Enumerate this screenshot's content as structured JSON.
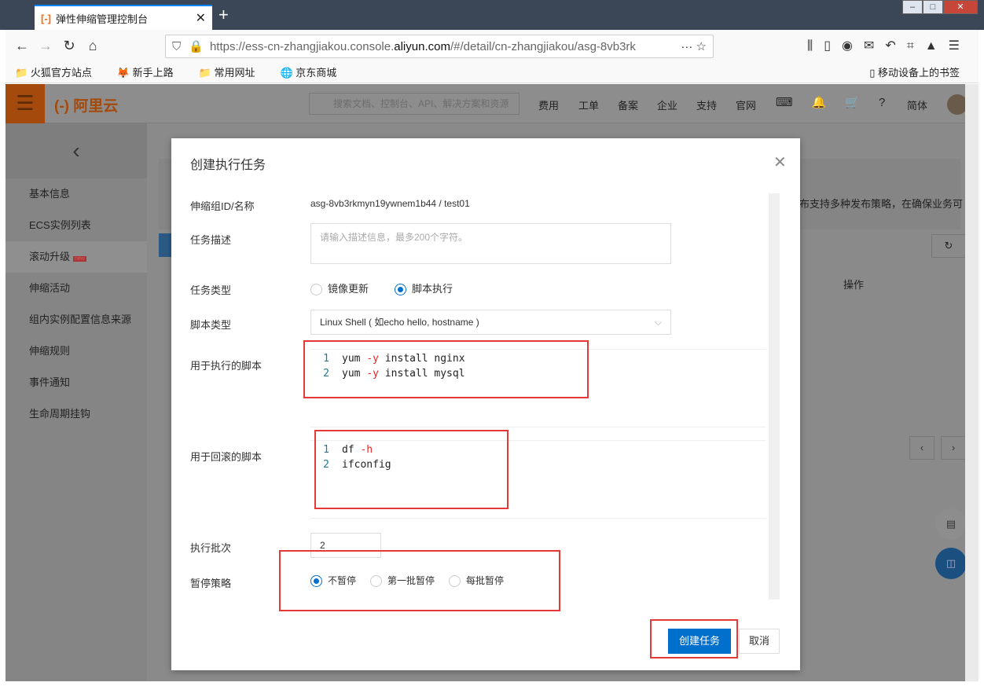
{
  "browser": {
    "tab_title": "弹性伸缩管理控制台",
    "url_prefix": "https://ess-cn-zhangjiakou.console.",
    "url_domain": "aliyun.com",
    "url_suffix": "/#/detail/cn-zhangjiakou/asg-8vb3rk",
    "bookmarks": [
      "火狐官方站点",
      "新手上路",
      "常用网址",
      "京东商城"
    ],
    "mobile_bookmarks": "移动设备上的书签"
  },
  "console": {
    "brand": "阿里云",
    "search_placeholder": "搜索文档、控制台、API、解决方案和资源",
    "nav": [
      "费用",
      "工单",
      "备案",
      "企业",
      "支持",
      "官网"
    ],
    "lang": "简体",
    "sidebar": [
      "基本信息",
      "ECS实例列表",
      "滚动升级",
      "伸缩活动",
      "组内实例配置信息来源",
      "伸缩规则",
      "事件通知",
      "生命周期挂钩"
    ],
    "new_badge": "new",
    "banner_text": "布支持多种发布策略，在确保业务可",
    "column_ops": "操作"
  },
  "modal": {
    "title": "创建执行任务",
    "group_label": "伸缩组ID/名称",
    "group_value": "asg-8vb3rkmyn19ywnem1b44 / test01",
    "desc_label": "任务描述",
    "desc_placeholder": "请输入描述信息，最多200个字符。",
    "type_label": "任务类型",
    "type_options": [
      "镜像更新",
      "脚本执行"
    ],
    "script_type_label": "脚本类型",
    "script_type_value": "Linux Shell ( 如echo hello, hostname )",
    "exec_label": "用于执行的脚本",
    "exec_script": [
      {
        "n": "1",
        "a": "yum ",
        "f": "-y",
        "b": " install nginx"
      },
      {
        "n": "2",
        "a": "yum ",
        "f": "-y",
        "b": " install mysql"
      }
    ],
    "rollback_label": "用于回滚的脚本",
    "rollback_script": [
      {
        "n": "1",
        "a": "df ",
        "f": "-h",
        "b": ""
      },
      {
        "n": "2",
        "a": "ifconfig",
        "f": "",
        "b": ""
      }
    ],
    "batch_label": "执行批次",
    "batch_value": "2",
    "pause_label": "暂停策略",
    "pause_options": [
      "不暂停",
      "第一批暂停",
      "每批暂停"
    ],
    "create_button": "创建任务",
    "cancel_button": "取消"
  }
}
